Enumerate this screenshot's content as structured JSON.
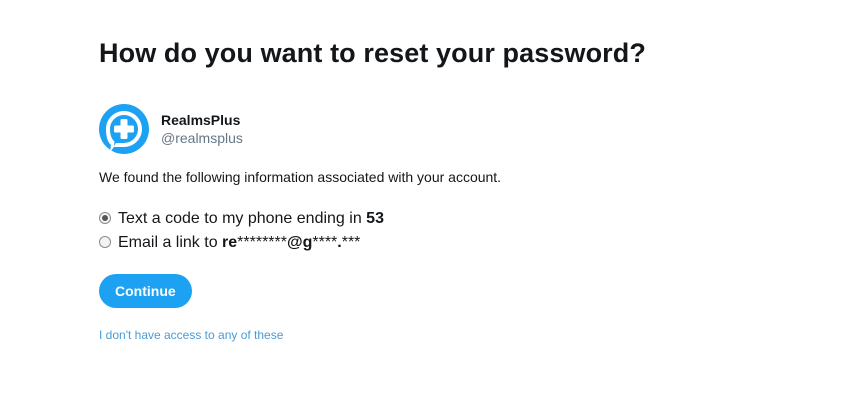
{
  "heading": "How do you want to reset your password?",
  "account": {
    "name": "RealmsPlus",
    "handle": "@realmsplus",
    "avatar_icon": "chat-bubble-plus-icon",
    "avatar_color": "#1da1f2"
  },
  "info_text": "We found the following information associated with your account.",
  "options": [
    {
      "selected": true,
      "label_prefix": "Text a code to my phone ending in ",
      "label_value": "53"
    },
    {
      "selected": false,
      "label_prefix": "Email a link to ",
      "label_value_bold_start": "re",
      "label_value_masked_1": "********",
      "label_value_bold_mid": "@g",
      "label_value_masked_2": "****",
      "label_value_bold_dot": ".",
      "label_value_masked_3": "***"
    }
  ],
  "continue_label": "Continue",
  "no_access_link": "I don't have access to any of these",
  "colors": {
    "accent": "#1da1f2",
    "link": "#4a9bd6",
    "secondary_text": "#657786"
  }
}
